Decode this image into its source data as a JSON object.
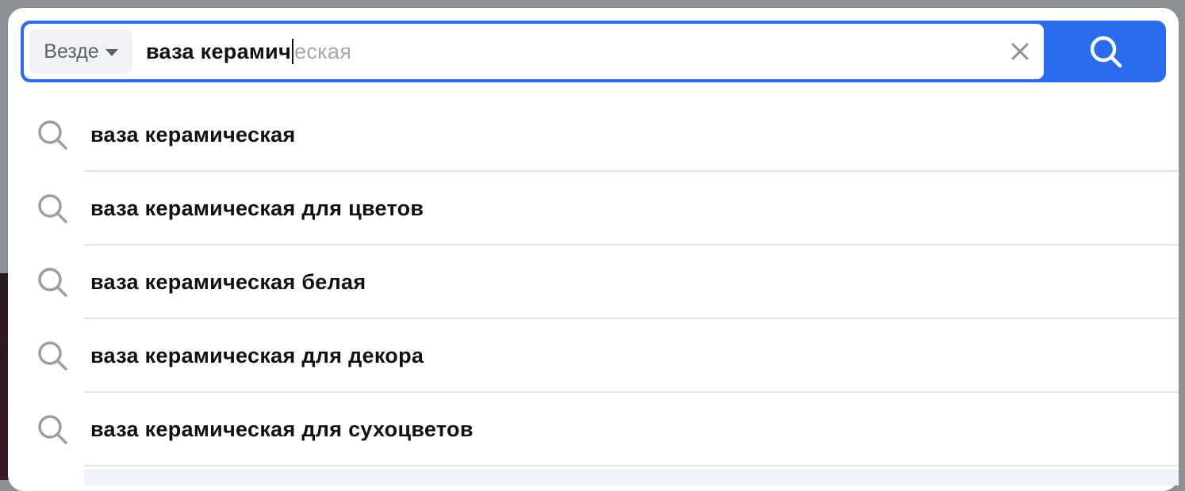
{
  "search": {
    "scope_label": "Везде",
    "typed_text": "ваза керамич",
    "autocomplete_text": "еская",
    "accent_color": "#2b6bf0"
  },
  "icons": {
    "scope_caret": "caret-down-icon",
    "clear": "close-icon",
    "submit": "search-icon",
    "suggestion": "search-icon"
  },
  "suggestions": [
    "ваза керамическая",
    "ваза керамическая для цветов",
    "ваза керамическая белая",
    "ваза керамическая для декора",
    "ваза керамическая для сухоцветов"
  ]
}
